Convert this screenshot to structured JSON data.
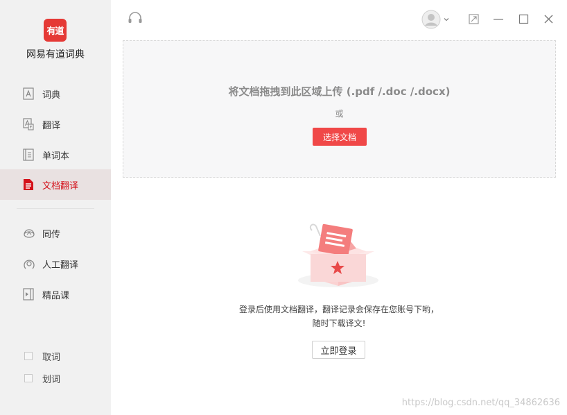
{
  "app": {
    "logo_text": "有道",
    "title": "网易有道词典"
  },
  "sidebar": {
    "items": [
      {
        "label": "词典",
        "icon": "dictionary-icon"
      },
      {
        "label": "翻译",
        "icon": "translate-icon"
      },
      {
        "label": "单词本",
        "icon": "wordbook-icon"
      },
      {
        "label": "文档翻译",
        "icon": "document-icon",
        "active": true
      },
      {
        "label": "同传",
        "icon": "interpretation-icon"
      },
      {
        "label": "人工翻译",
        "icon": "human-translation-icon"
      },
      {
        "label": "精品课",
        "icon": "course-icon"
      }
    ],
    "options": [
      {
        "label": "取词",
        "checked": false
      },
      {
        "label": "划词",
        "checked": false
      }
    ]
  },
  "upload": {
    "title": "将文档拖拽到此区域上传 (.pdf /.doc /.docx)",
    "or": "或",
    "select_button": "选择文档"
  },
  "login": {
    "hint_line1": "登录后使用文档翻译，翻译记录会保存在您账号下哟，",
    "hint_line2": "随时下载译文!",
    "button": "立即登录"
  },
  "watermark": "https://blog.csdn.net/qq_34862636",
  "colors": {
    "accent": "#e53935",
    "active_bg": "#e9e1e1",
    "button_red": "#f04848"
  }
}
